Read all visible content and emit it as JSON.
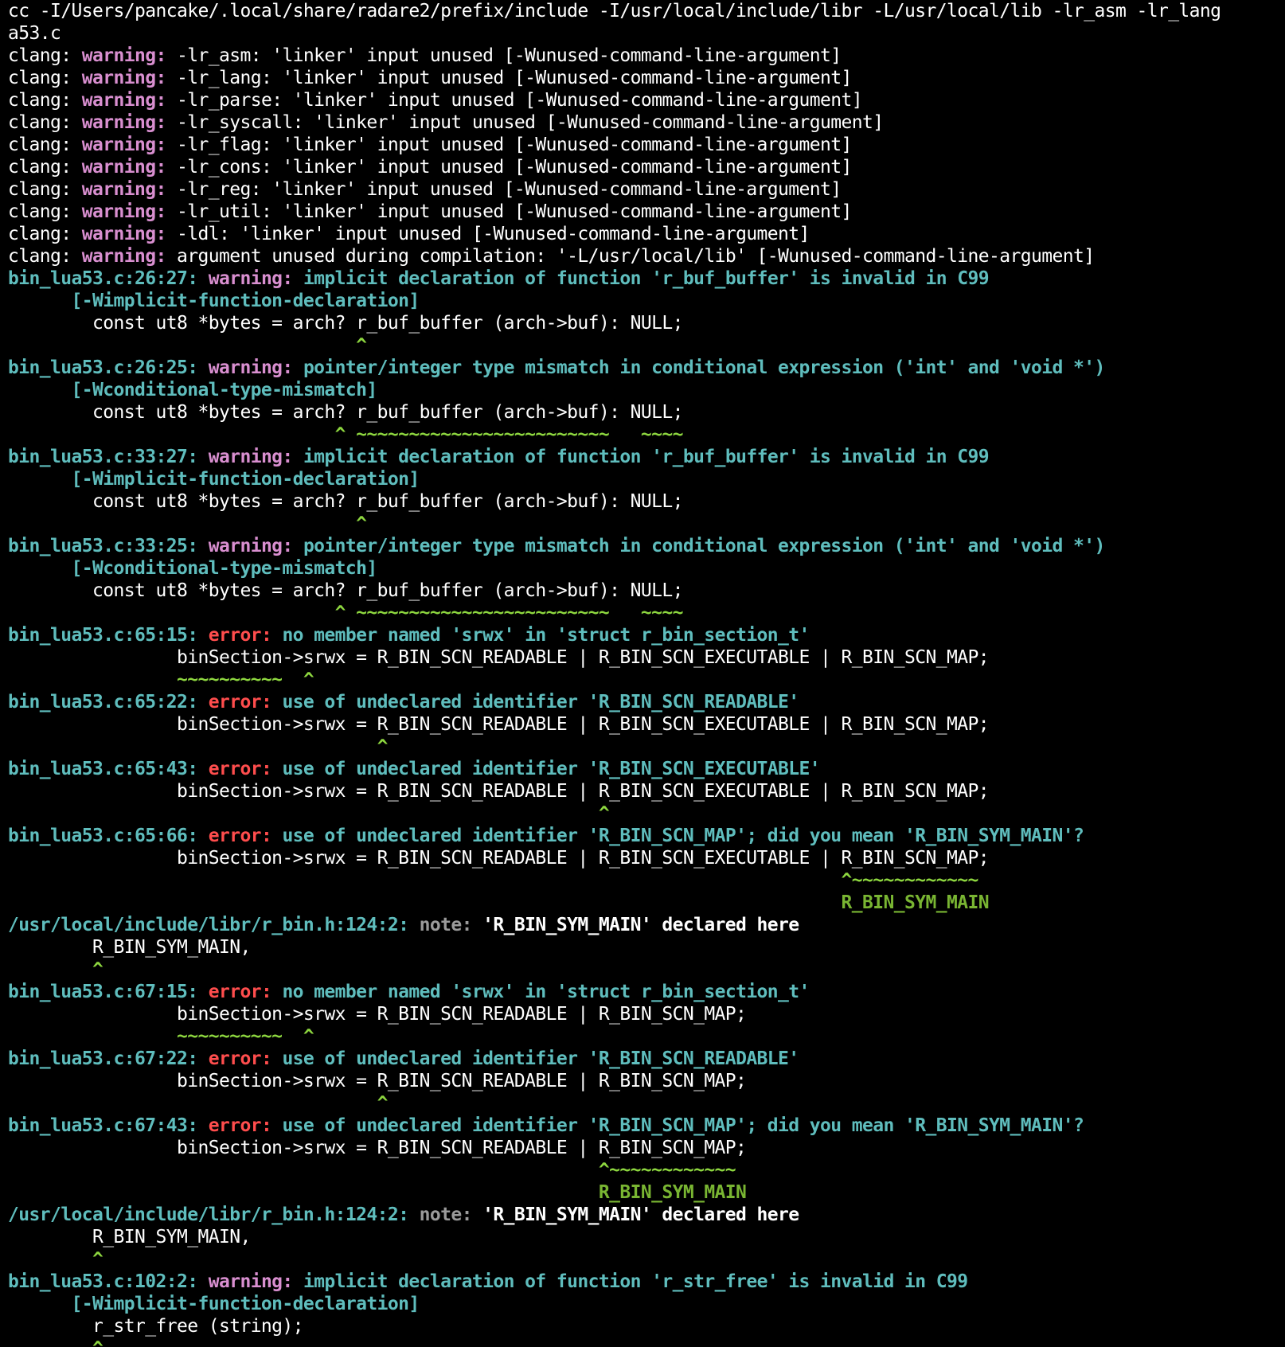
{
  "palette": {
    "background": "#000000",
    "default": "#ffffff",
    "location": "#5fbdbd",
    "warning": "#d98fd0",
    "error": "#ff4d4d",
    "caret": "#8dd63f",
    "fixit": "#79b532",
    "note": "#9a9a9a"
  },
  "terminal": {
    "lines": [
      [
        [
          "d",
          "cc -I/Users/pancake/.local/share/radare2/prefix/include -I/usr/local/include/libr -L/usr/local/lib -lr_asm -lr_lang"
        ]
      ],
      [
        [
          "d",
          "a53.c"
        ]
      ],
      [
        [
          "d",
          "clang: "
        ],
        [
          "m",
          "warning:"
        ],
        [
          "d",
          " -lr_asm: 'linker' input unused [-Wunused-command-line-argument]"
        ]
      ],
      [
        [
          "d",
          "clang: "
        ],
        [
          "m",
          "warning:"
        ],
        [
          "d",
          " -lr_lang: 'linker' input unused [-Wunused-command-line-argument]"
        ]
      ],
      [
        [
          "d",
          "clang: "
        ],
        [
          "m",
          "warning:"
        ],
        [
          "d",
          " -lr_parse: 'linker' input unused [-Wunused-command-line-argument]"
        ]
      ],
      [
        [
          "d",
          "clang: "
        ],
        [
          "m",
          "warning:"
        ],
        [
          "d",
          " -lr_syscall: 'linker' input unused [-Wunused-command-line-argument]"
        ]
      ],
      [
        [
          "d",
          "clang: "
        ],
        [
          "m",
          "warning:"
        ],
        [
          "d",
          " -lr_flag: 'linker' input unused [-Wunused-command-line-argument]"
        ]
      ],
      [
        [
          "d",
          "clang: "
        ],
        [
          "m",
          "warning:"
        ],
        [
          "d",
          " -lr_cons: 'linker' input unused [-Wunused-command-line-argument]"
        ]
      ],
      [
        [
          "d",
          "clang: "
        ],
        [
          "m",
          "warning:"
        ],
        [
          "d",
          " -lr_reg: 'linker' input unused [-Wunused-command-line-argument]"
        ]
      ],
      [
        [
          "d",
          "clang: "
        ],
        [
          "m",
          "warning:"
        ],
        [
          "d",
          " -lr_util: 'linker' input unused [-Wunused-command-line-argument]"
        ]
      ],
      [
        [
          "d",
          "clang: "
        ],
        [
          "m",
          "warning:"
        ],
        [
          "d",
          " -ldl: 'linker' input unused [-Wunused-command-line-argument]"
        ]
      ],
      [
        [
          "d",
          "clang: "
        ],
        [
          "m",
          "warning:"
        ],
        [
          "d",
          " argument unused during compilation: '-L/usr/local/lib' [-Wunused-command-line-argument]"
        ]
      ],
      [
        [
          "c",
          "bin_lua53.c:26:27: "
        ],
        [
          "m",
          "warning: "
        ],
        [
          "c",
          "implicit declaration of function 'r_buf_buffer' is invalid in C99"
        ]
      ],
      [
        [
          "c",
          "      [-Wimplicit-function-declaration]"
        ]
      ],
      [
        [
          "d",
          "        const ut8 *bytes = arch? r_buf_buffer (arch->buf): NULL;"
        ]
      ],
      [
        [
          "g",
          "                                 ^"
        ]
      ],
      [
        [
          "c",
          "bin_lua53.c:26:25: "
        ],
        [
          "m",
          "warning: "
        ],
        [
          "c",
          "pointer/integer type mismatch in conditional expression ('int' and 'void *')"
        ]
      ],
      [
        [
          "c",
          "      [-Wconditional-type-mismatch]"
        ]
      ],
      [
        [
          "d",
          "        const ut8 *bytes = arch? r_buf_buffer (arch->buf): NULL;"
        ]
      ],
      [
        [
          "g",
          "                               ^ ~~~~~~~~~~~~~~~~~~~~~~~~   ~~~~"
        ]
      ],
      [
        [
          "c",
          "bin_lua53.c:33:27: "
        ],
        [
          "m",
          "warning: "
        ],
        [
          "c",
          "implicit declaration of function 'r_buf_buffer' is invalid in C99"
        ]
      ],
      [
        [
          "c",
          "      [-Wimplicit-function-declaration]"
        ]
      ],
      [
        [
          "d",
          "        const ut8 *bytes = arch? r_buf_buffer (arch->buf): NULL;"
        ]
      ],
      [
        [
          "g",
          "                                 ^"
        ]
      ],
      [
        [
          "c",
          "bin_lua53.c:33:25: "
        ],
        [
          "m",
          "warning: "
        ],
        [
          "c",
          "pointer/integer type mismatch in conditional expression ('int' and 'void *')"
        ]
      ],
      [
        [
          "c",
          "      [-Wconditional-type-mismatch]"
        ]
      ],
      [
        [
          "d",
          "        const ut8 *bytes = arch? r_buf_buffer (arch->buf): NULL;"
        ]
      ],
      [
        [
          "g",
          "                               ^ ~~~~~~~~~~~~~~~~~~~~~~~~   ~~~~"
        ]
      ],
      [
        [
          "c",
          "bin_lua53.c:65:15: "
        ],
        [
          "r",
          "error: "
        ],
        [
          "c",
          "no member named 'srwx' in 'struct r_bin_section_t'"
        ]
      ],
      [
        [
          "d",
          "                binSection->srwx = R_BIN_SCN_READABLE | R_BIN_SCN_EXECUTABLE | R_BIN_SCN_MAP;"
        ]
      ],
      [
        [
          "g",
          "                ~~~~~~~~~~  ^"
        ]
      ],
      [
        [
          "c",
          "bin_lua53.c:65:22: "
        ],
        [
          "r",
          "error: "
        ],
        [
          "c",
          "use of undeclared identifier 'R_BIN_SCN_READABLE'"
        ]
      ],
      [
        [
          "d",
          "                binSection->srwx = R_BIN_SCN_READABLE | R_BIN_SCN_EXECUTABLE | R_BIN_SCN_MAP;"
        ]
      ],
      [
        [
          "g",
          "                                   ^"
        ]
      ],
      [
        [
          "c",
          "bin_lua53.c:65:43: "
        ],
        [
          "r",
          "error: "
        ],
        [
          "c",
          "use of undeclared identifier 'R_BIN_SCN_EXECUTABLE'"
        ]
      ],
      [
        [
          "d",
          "                binSection->srwx = R_BIN_SCN_READABLE | R_BIN_SCN_EXECUTABLE | R_BIN_SCN_MAP;"
        ]
      ],
      [
        [
          "g",
          "                                                        ^"
        ]
      ],
      [
        [
          "c",
          "bin_lua53.c:65:66: "
        ],
        [
          "r",
          "error: "
        ],
        [
          "c",
          "use of undeclared identifier 'R_BIN_SCN_MAP'; did you mean 'R_BIN_SYM_MAIN'?"
        ]
      ],
      [
        [
          "d",
          "                binSection->srwx = R_BIN_SCN_READABLE | R_BIN_SCN_EXECUTABLE | R_BIN_SCN_MAP;"
        ]
      ],
      [
        [
          "g",
          "                                                                               ^~~~~~~~~~~~~"
        ]
      ],
      [
        [
          "f",
          "                                                                               R_BIN_SYM_MAIN"
        ]
      ],
      [
        [
          "c",
          "/usr/local/include/libr/r_bin.h:124:2: "
        ],
        [
          "y",
          "note: "
        ],
        [
          "w",
          "'R_BIN_SYM_MAIN' declared here"
        ]
      ],
      [
        [
          "d",
          "        R_BIN_SYM_MAIN,"
        ]
      ],
      [
        [
          "g",
          "        ^"
        ]
      ],
      [
        [
          "c",
          "bin_lua53.c:67:15: "
        ],
        [
          "r",
          "error: "
        ],
        [
          "c",
          "no member named 'srwx' in 'struct r_bin_section_t'"
        ]
      ],
      [
        [
          "d",
          "                binSection->srwx = R_BIN_SCN_READABLE | R_BIN_SCN_MAP;"
        ]
      ],
      [
        [
          "g",
          "                ~~~~~~~~~~  ^"
        ]
      ],
      [
        [
          "c",
          "bin_lua53.c:67:22: "
        ],
        [
          "r",
          "error: "
        ],
        [
          "c",
          "use of undeclared identifier 'R_BIN_SCN_READABLE'"
        ]
      ],
      [
        [
          "d",
          "                binSection->srwx = R_BIN_SCN_READABLE | R_BIN_SCN_MAP;"
        ]
      ],
      [
        [
          "g",
          "                                   ^"
        ]
      ],
      [
        [
          "c",
          "bin_lua53.c:67:43: "
        ],
        [
          "r",
          "error: "
        ],
        [
          "c",
          "use of undeclared identifier 'R_BIN_SCN_MAP'; did you mean 'R_BIN_SYM_MAIN'?"
        ]
      ],
      [
        [
          "d",
          "                binSection->srwx = R_BIN_SCN_READABLE | R_BIN_SCN_MAP;"
        ]
      ],
      [
        [
          "g",
          "                                                        ^~~~~~~~~~~~~"
        ]
      ],
      [
        [
          "f",
          "                                                        R_BIN_SYM_MAIN"
        ]
      ],
      [
        [
          "c",
          "/usr/local/include/libr/r_bin.h:124:2: "
        ],
        [
          "y",
          "note: "
        ],
        [
          "w",
          "'R_BIN_SYM_MAIN' declared here"
        ]
      ],
      [
        [
          "d",
          "        R_BIN_SYM_MAIN,"
        ]
      ],
      [
        [
          "g",
          "        ^"
        ]
      ],
      [
        [
          "c",
          "bin_lua53.c:102:2: "
        ],
        [
          "m",
          "warning: "
        ],
        [
          "c",
          "implicit declaration of function 'r_str_free' is invalid in C99"
        ]
      ],
      [
        [
          "c",
          "      [-Wimplicit-function-declaration]"
        ]
      ],
      [
        [
          "d",
          "        r_str_free (string);"
        ]
      ],
      [
        [
          "g",
          "        ^"
        ]
      ]
    ]
  }
}
